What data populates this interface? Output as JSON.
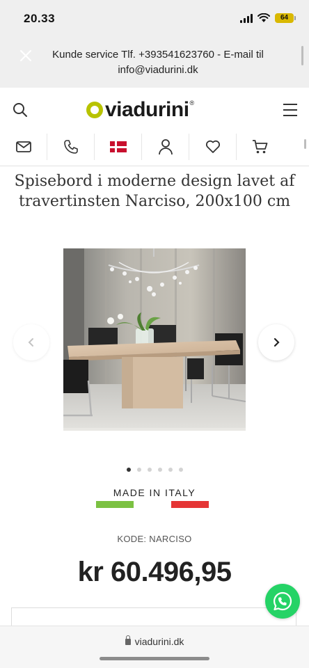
{
  "status_bar": {
    "time": "20.33",
    "battery": "64"
  },
  "announcement": {
    "text": "Kunde service Tlf. +393541623760 - E-mail til info@viadurini.dk"
  },
  "header": {
    "logo_text": "viadurini",
    "logo_reg": "®"
  },
  "icon_row": [
    "mail-icon",
    "phone-icon",
    "denmark-flag-icon",
    "user-icon",
    "heart-icon",
    "cart-icon"
  ],
  "product": {
    "title": "Spisebord i moderne design lavet af travertinsten Narciso, 200x100 cm",
    "made_in": "MADE IN ITALY",
    "code": "KODE: NARCISO",
    "price": "kr 60.496,95"
  },
  "gallery": {
    "total_images": 6,
    "active_index": 0
  },
  "colors": {
    "italy_green": "#7bc142",
    "italy_red": "#e53535",
    "whatsapp": "#25d366",
    "logo_accent": "#b8c300"
  },
  "browser": {
    "url": "viadurini.dk"
  }
}
